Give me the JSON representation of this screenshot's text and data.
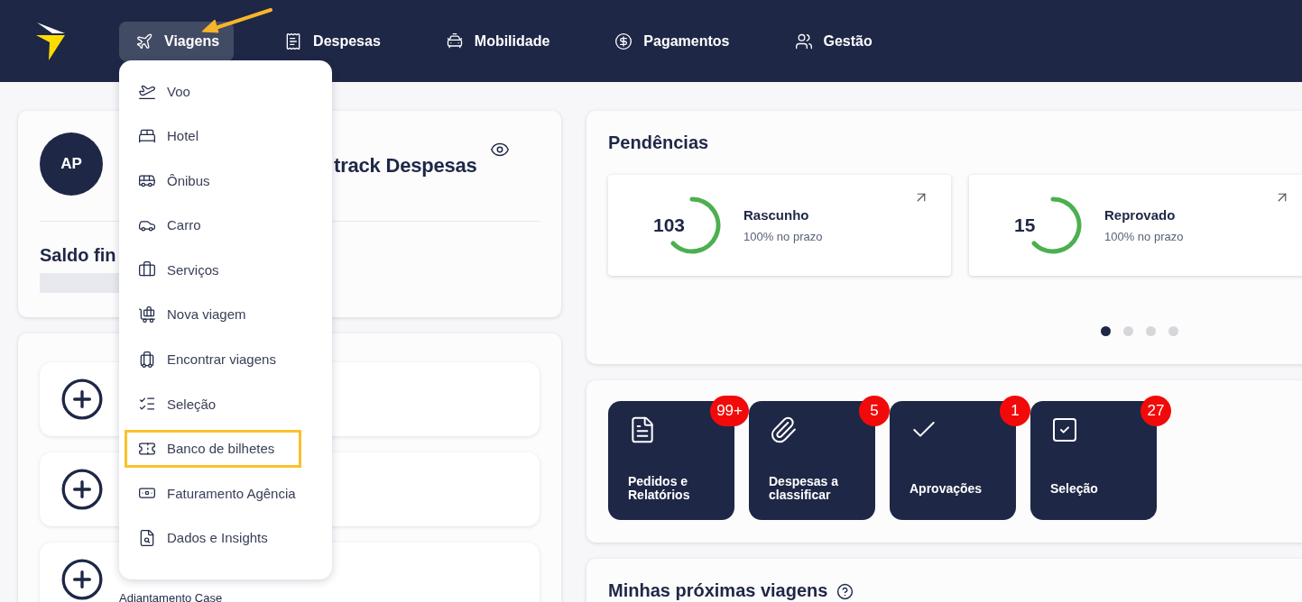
{
  "nav": {
    "items": [
      {
        "label": "Viagens",
        "selected": true
      },
      {
        "label": "Despesas",
        "selected": false
      },
      {
        "label": "Mobilidade",
        "selected": false
      },
      {
        "label": "Pagamentos",
        "selected": false
      },
      {
        "label": "Gestão",
        "selected": false
      }
    ]
  },
  "menu": {
    "items": [
      {
        "label": "Voo",
        "highlighted": false
      },
      {
        "label": "Hotel",
        "highlighted": false
      },
      {
        "label": "Ônibus",
        "highlighted": false
      },
      {
        "label": "Carro",
        "highlighted": false
      },
      {
        "label": "Serviços",
        "highlighted": false
      },
      {
        "label": "Nova viagem",
        "highlighted": false
      },
      {
        "label": "Encontrar viagens",
        "highlighted": false
      },
      {
        "label": "Seleção",
        "highlighted": false
      },
      {
        "label": "Banco de bilhetes",
        "highlighted": true
      },
      {
        "label": "Faturamento Agência",
        "highlighted": false
      },
      {
        "label": "Dados e Insights",
        "highlighted": false
      }
    ]
  },
  "profile": {
    "initials": "AP",
    "title": "track Despesas",
    "balance_label": "Saldo fin"
  },
  "shortcut_rows": [
    {
      "kind": "blank"
    },
    {
      "kind": "blank"
    },
    {
      "kind": "labelled",
      "label": "Adiantamento Case"
    }
  ],
  "pending": {
    "title": "Pendências",
    "cards": [
      {
        "count": "103",
        "label": "Rascunho",
        "sub": "100% no prazo"
      },
      {
        "count": "15",
        "label": "Reprovado",
        "sub": "100% no prazo"
      }
    ],
    "dots": [
      {
        "selected": true
      },
      {
        "selected": false
      },
      {
        "selected": false
      },
      {
        "selected": false
      }
    ]
  },
  "actions": [
    {
      "label": "Pedidos e Relatórios",
      "badge": "99+"
    },
    {
      "label": "Despesas a classificar",
      "badge": "5"
    },
    {
      "label": "Aprovações",
      "badge": "1"
    },
    {
      "label": "Seleção",
      "badge": "27"
    }
  ],
  "trips": {
    "title": "Minhas próximas viagens"
  }
}
